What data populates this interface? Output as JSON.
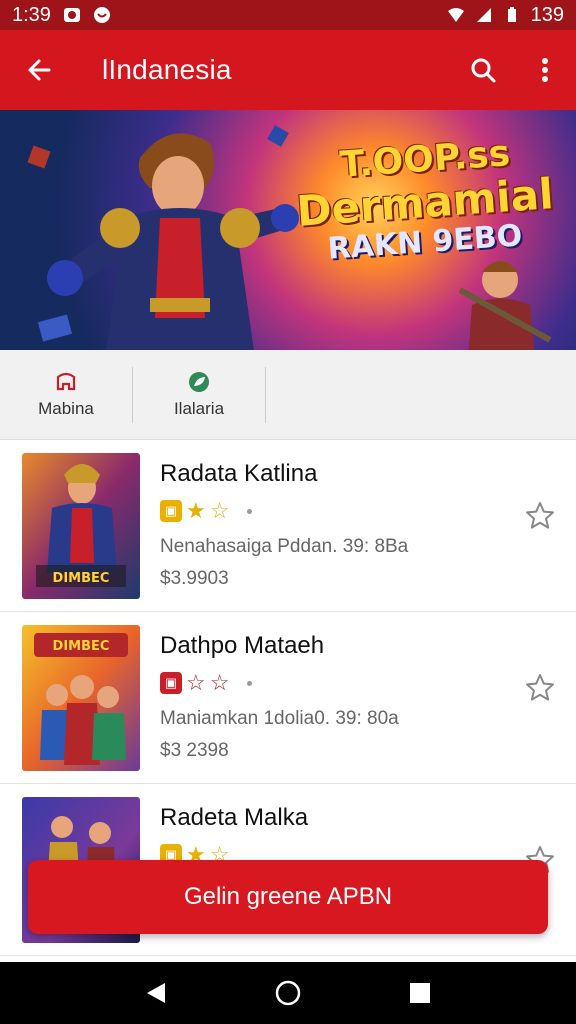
{
  "status_bar": {
    "time": "1:39",
    "battery": "139",
    "icons": [
      "notification-icon",
      "notification-icon",
      "wifi-icon",
      "signal-icon",
      "battery-icon"
    ]
  },
  "app_bar": {
    "title": "lIndanesia",
    "icons": [
      "back-arrow-icon",
      "search-icon",
      "more-vert-icon"
    ],
    "color": "#d4161f"
  },
  "banner": {
    "line1": "T.OOP.ss",
    "line2": "Dermamial",
    "line3": "RAKN 9EBO"
  },
  "tabs": [
    {
      "label": "Mabina",
      "icon": "gamepad-icon",
      "color": "#c8202a"
    },
    {
      "label": "Ilalaria",
      "icon": "leaf-icon",
      "color": "#2e8b57"
    }
  ],
  "list": {
    "items": [
      {
        "name": "Radata Katlina",
        "badge_color": "#e8b100",
        "stars_filled": 1,
        "description": "Nenahasaiga Pddan. 39: 8Ba",
        "price": "$3.9903",
        "thumb_label": "DIMBEC"
      },
      {
        "name": "Dathpo Mataeh",
        "badge_color": "#c8202a",
        "stars_filled": 0,
        "description": "Maniamkan 1dolia0. 39: 80a",
        "price": "$3 2398",
        "thumb_label": "DIMBEC"
      },
      {
        "name": "Radeta Malka",
        "badge_color": "#e8b100",
        "stars_filled": 1,
        "description": "",
        "price": "",
        "thumb_label": ""
      }
    ]
  },
  "cta": {
    "label": "Gelin greene APBN",
    "color": "#d81821"
  },
  "nav": {
    "icons": [
      "back-triangle-icon",
      "home-circle-icon",
      "recents-square-icon"
    ]
  }
}
